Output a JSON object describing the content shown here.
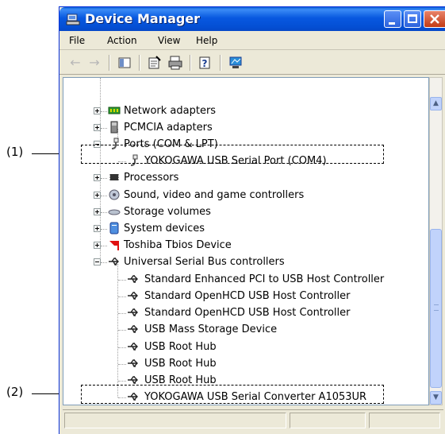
{
  "window": {
    "title": "Device Manager"
  },
  "menu": [
    "File",
    "Action",
    "View",
    "Help"
  ],
  "toolbar": {
    "back_icon": "back-arrow-icon",
    "forward_icon": "forward-arrow-icon",
    "tools": [
      "show-hide-console-tree-icon",
      "properties-icon",
      "print-icon",
      "help-icon",
      "monitor-icon"
    ]
  },
  "tree": {
    "items": [
      {
        "label": "Network adapters",
        "icon": "network-adapter-icon"
      },
      {
        "label": "PCMCIA adapters",
        "icon": "pcmcia-card-icon"
      },
      {
        "label": "Ports (COM & LPT)",
        "icon": "port-icon"
      },
      {
        "label": "YOKOGAWA USB Serial Port (COM4)",
        "icon": "port-icon"
      },
      {
        "label": "Processors",
        "icon": "processor-icon"
      },
      {
        "label": "Sound, video and game controllers",
        "icon": "sound-icon"
      },
      {
        "label": "Storage volumes",
        "icon": "storage-volume-icon"
      },
      {
        "label": "System devices",
        "icon": "computer-icon"
      },
      {
        "label": "Toshiba Tbios Device",
        "icon": "toshiba-flag-icon"
      },
      {
        "label": "Universal Serial Bus controllers",
        "icon": "usb-icon"
      },
      {
        "label": "Standard Enhanced PCI to USB Host Controller",
        "icon": "usb-icon"
      },
      {
        "label": "Standard OpenHCD USB Host Controller",
        "icon": "usb-icon"
      },
      {
        "label": "Standard OpenHCD USB Host Controller",
        "icon": "usb-icon"
      },
      {
        "label": "USB Mass Storage Device",
        "icon": "usb-icon"
      },
      {
        "label": "USB Root Hub",
        "icon": "usb-icon"
      },
      {
        "label": "USB Root Hub",
        "icon": "usb-icon"
      },
      {
        "label": "USB Root Hub",
        "icon": "usb-icon"
      },
      {
        "label": "YOKOGAWA USB Serial Converter A1053UR",
        "icon": "usb-icon"
      }
    ]
  },
  "callouts": {
    "one": "(1)",
    "two": "(2)"
  },
  "colors": {
    "titlebar": "#0858e0",
    "close": "#c23a14",
    "toshiba_red": "#e01010"
  }
}
